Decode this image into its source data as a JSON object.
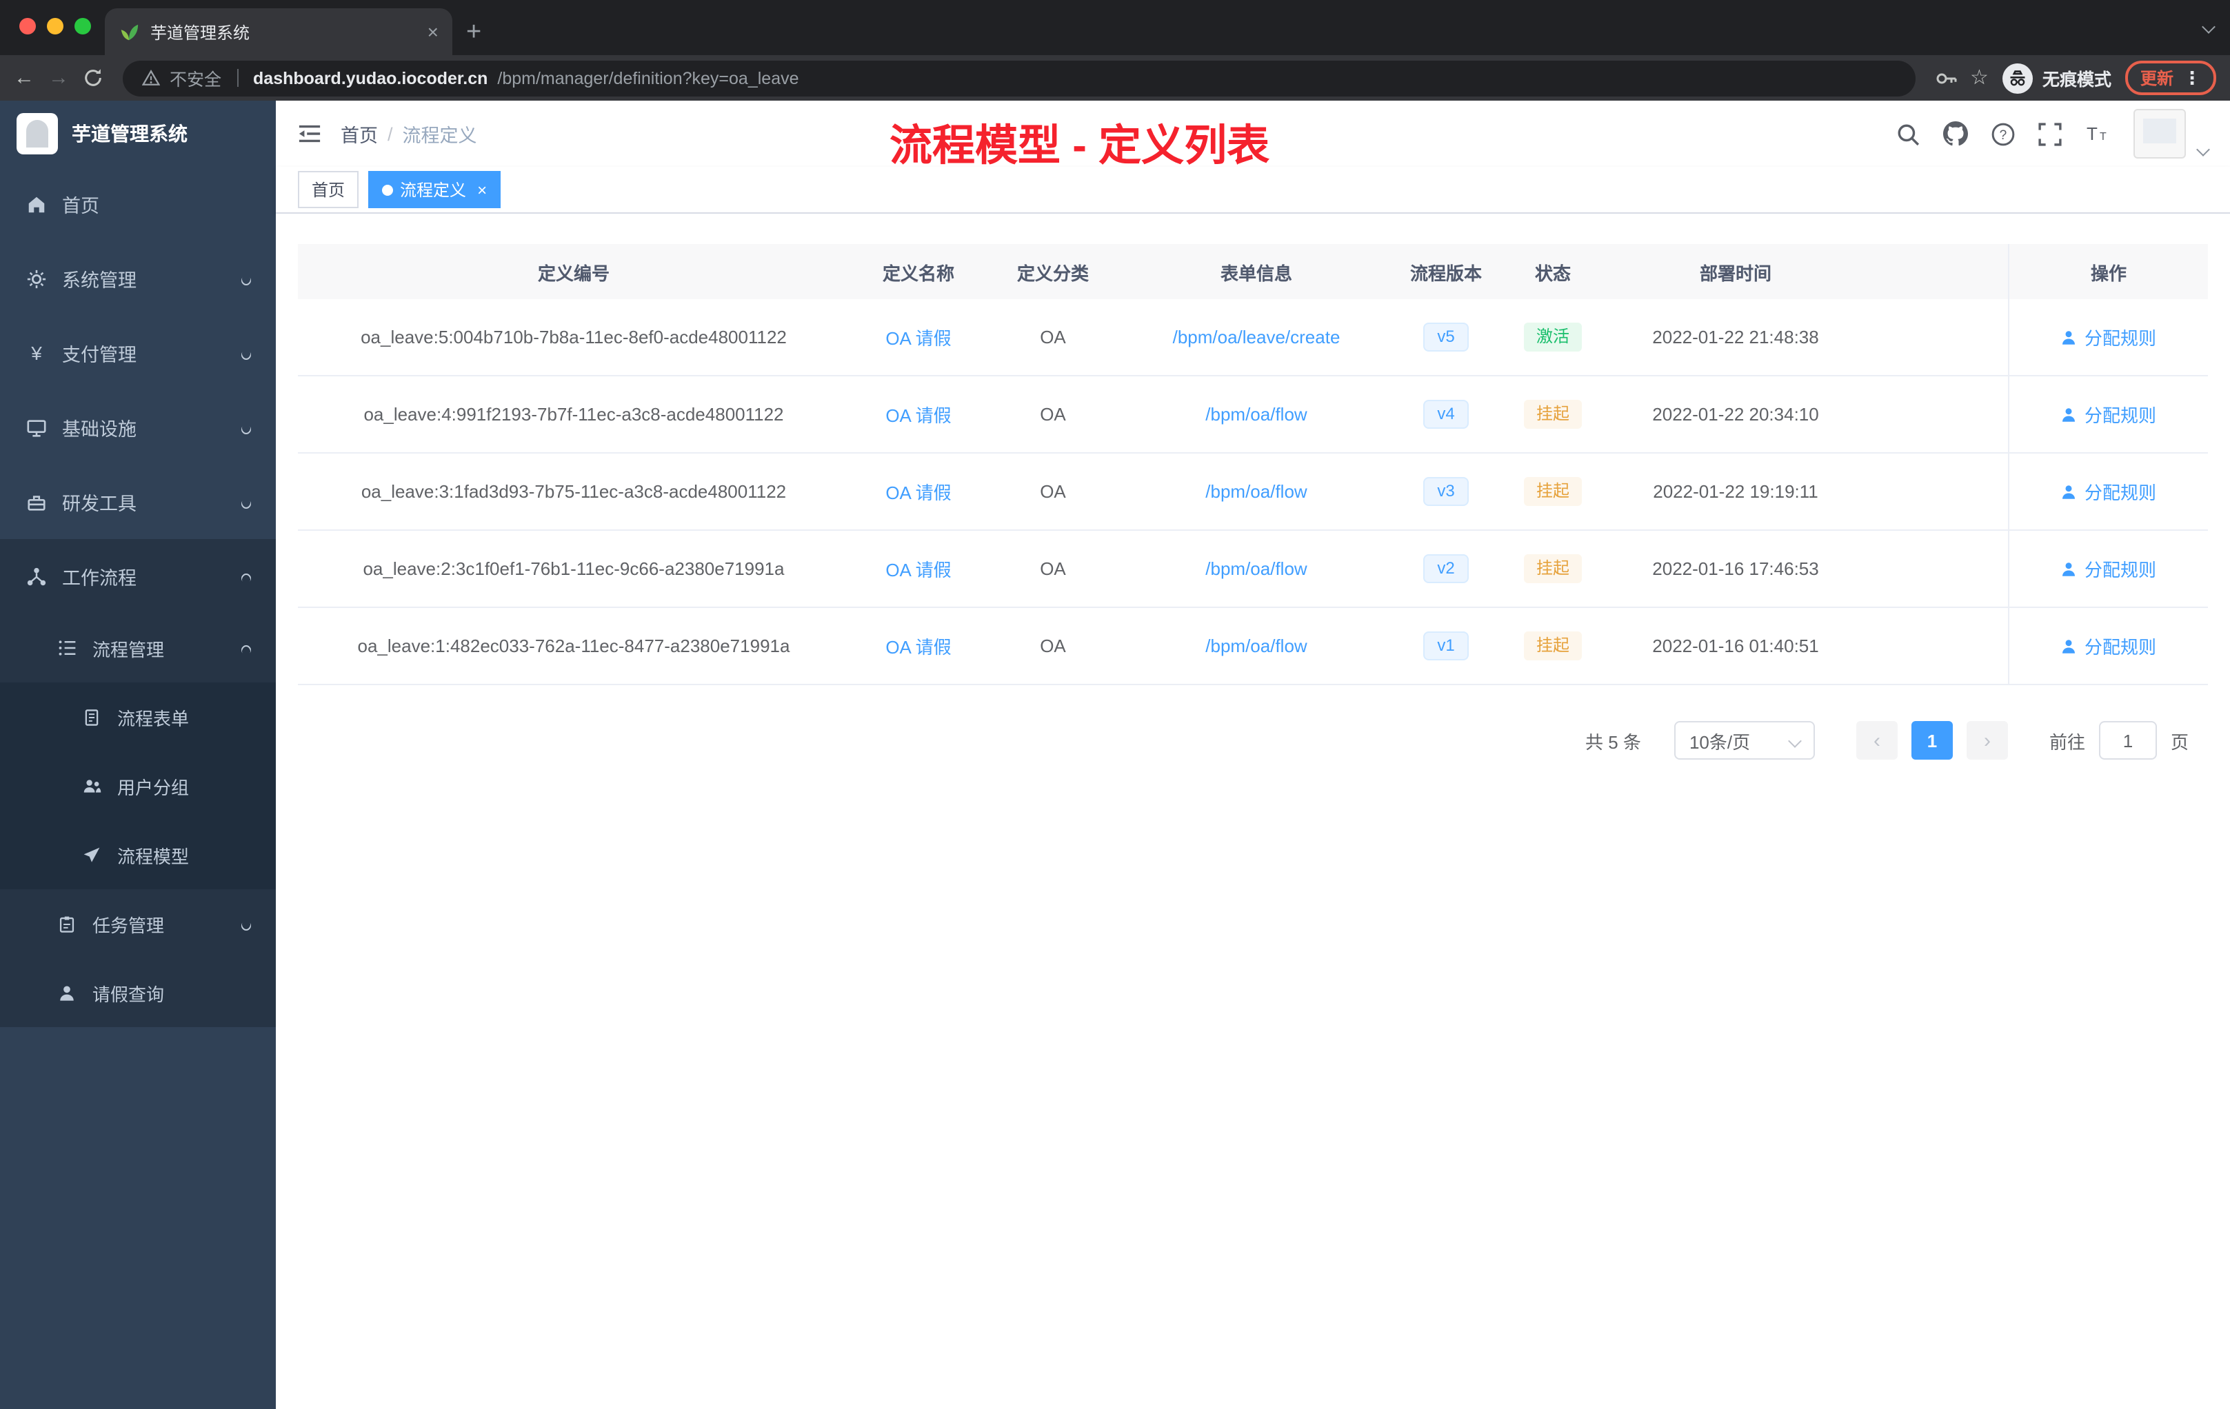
{
  "browser": {
    "tab": {
      "title": "芋道管理系统"
    },
    "new_tab_label": "+",
    "security_label": "不安全",
    "url": {
      "host": "dashboard.yudao.iocoder.cn",
      "path": "/bpm/manager/definition?key=oa_leave"
    },
    "incognito_label": "无痕模式",
    "update_label": "更新"
  },
  "sidebar": {
    "title": "芋道管理系统",
    "items": [
      {
        "label": "首页",
        "icon": "home-icon"
      },
      {
        "label": "系统管理",
        "icon": "gear-icon"
      },
      {
        "label": "支付管理",
        "icon": "yen-icon"
      },
      {
        "label": "基础设施",
        "icon": "monitor-icon"
      },
      {
        "label": "研发工具",
        "icon": "toolbox-icon"
      },
      {
        "label": "工作流程",
        "icon": "workflow-icon"
      },
      {
        "label": "流程管理",
        "icon": "list-icon"
      },
      {
        "label": "流程表单",
        "icon": "form-icon"
      },
      {
        "label": "用户分组",
        "icon": "user-group-icon"
      },
      {
        "label": "流程模型",
        "icon": "paper-plane-icon"
      },
      {
        "label": "任务管理",
        "icon": "task-icon"
      },
      {
        "label": "请假查询",
        "icon": "person-icon"
      }
    ]
  },
  "header": {
    "breadcrumb": {
      "home": "首页",
      "separator": "/",
      "current": "流程定义"
    },
    "annotation": "流程模型 - 定义列表"
  },
  "tags": {
    "home": "首页",
    "active": "流程定义"
  },
  "table": {
    "columns": [
      "定义编号",
      "定义名称",
      "定义分类",
      "表单信息",
      "流程版本",
      "状态",
      "部署时间",
      "操作"
    ],
    "action_label": "分配规则",
    "rows": [
      {
        "id": "oa_leave:5:004b710b-7b8a-11ec-8ef0-acde48001122",
        "name": "OA 请假",
        "category": "OA",
        "form": "/bpm/oa/leave/create",
        "version": "v5",
        "status": "激活",
        "time": "2022-01-22 21:48:38"
      },
      {
        "id": "oa_leave:4:991f2193-7b7f-11ec-a3c8-acde48001122",
        "name": "OA 请假",
        "category": "OA",
        "form": "/bpm/oa/flow",
        "version": "v4",
        "status": "挂起",
        "time": "2022-01-22 20:34:10"
      },
      {
        "id": "oa_leave:3:1fad3d93-7b75-11ec-a3c8-acde48001122",
        "name": "OA 请假",
        "category": "OA",
        "form": "/bpm/oa/flow",
        "version": "v3",
        "status": "挂起",
        "time": "2022-01-22 19:19:11"
      },
      {
        "id": "oa_leave:2:3c1f0ef1-76b1-11ec-9c66-a2380e71991a",
        "name": "OA 请假",
        "category": "OA",
        "form": "/bpm/oa/flow",
        "version": "v2",
        "status": "挂起",
        "time": "2022-01-16 17:46:53"
      },
      {
        "id": "oa_leave:1:482ec033-762a-11ec-8477-a2380e71991a",
        "name": "OA 请假",
        "category": "OA",
        "form": "/bpm/oa/flow",
        "version": "v1",
        "status": "挂起",
        "time": "2022-01-16 01:40:51"
      }
    ]
  },
  "pagination": {
    "total": "共 5 条",
    "page_size": "10条/页",
    "current_page": "1",
    "goto_prefix": "前往",
    "goto_value": "1",
    "goto_suffix": "页"
  },
  "colors": {
    "accent": "#409eff",
    "success": "#19be6b",
    "warning": "#e6a23c",
    "annotation_red": "#f5222d",
    "sidebar_bg": "#304156"
  }
}
